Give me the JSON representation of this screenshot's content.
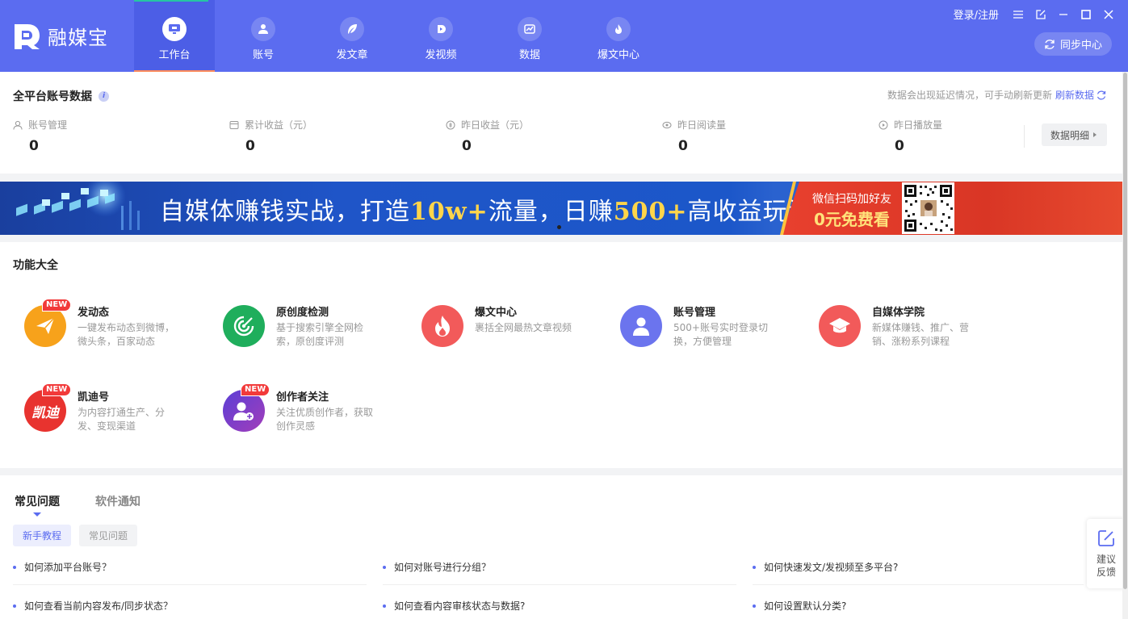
{
  "app": {
    "logo_text": "融媒宝"
  },
  "nav": {
    "tabs": [
      {
        "label": "工作台",
        "icon": "monitor-icon"
      },
      {
        "label": "账号",
        "icon": "user-icon"
      },
      {
        "label": "发文章",
        "icon": "feather-icon"
      },
      {
        "label": "发视频",
        "icon": "play-icon"
      },
      {
        "label": "数据",
        "icon": "chart-icon"
      },
      {
        "label": "爆文中心",
        "icon": "flame-icon"
      }
    ],
    "active_index": 0
  },
  "header": {
    "login_label": "登录/注册",
    "sync_label": "同步中心"
  },
  "stats": {
    "title": "全平台账号数据",
    "note": "数据会出现延迟情况，可手动刷新更新",
    "refresh_label": "刷新数据",
    "items": [
      {
        "label": "账号管理",
        "value": "0"
      },
      {
        "label": "累计收益（元）",
        "value": "0"
      },
      {
        "label": "昨日收益（元）",
        "value": "0"
      },
      {
        "label": "昨日阅读量",
        "value": "0"
      },
      {
        "label": "昨日播放量",
        "value": "0"
      }
    ],
    "detail_label": "数据明细"
  },
  "banner": {
    "text_a": "自媒体赚钱实战，打造",
    "text_hl1": "10w+",
    "text_b": "流量，日赚",
    "text_hl2": "500+",
    "text_c": "高收益玩法",
    "sub1": "微信扫码加好友",
    "sub2": "0元免费看"
  },
  "features": {
    "title": "功能大全",
    "badge_text": "NEW",
    "items": [
      {
        "name": "发动态",
        "desc": "一键发布动态到微博，微头条，百家动态",
        "badge": true,
        "color": "#f7a21b"
      },
      {
        "name": "原创度检测",
        "desc": "基于搜索引擎全网检索，原创度评测",
        "badge": false,
        "color": "#1fae5c"
      },
      {
        "name": "爆文中心",
        "desc": "裹括全网最热文章视频",
        "badge": false,
        "color": "#f25a5a"
      },
      {
        "name": "账号管理",
        "desc": "500+账号实时登录切换，方便管理",
        "badge": false,
        "color": "#6b74ee"
      },
      {
        "name": "自媒体学院",
        "desc": "新媒体赚钱、推广、营销、涨粉系列课程",
        "badge": false,
        "color": "#f25a5a"
      },
      {
        "name": "凯迪号",
        "desc": "为内容打通生产、分发、变现渠道",
        "badge": true,
        "color": "#e8332f",
        "logo_text": "凯迪"
      },
      {
        "name": "创作者关注",
        "desc": "关注优质创作者，获取创作灵感",
        "badge": true,
        "color": "#7a3fc9"
      }
    ]
  },
  "faq": {
    "tabs": [
      "常见问题",
      "软件通知"
    ],
    "pills": [
      "新手教程",
      "常见问题"
    ],
    "questions": [
      "如何添加平台账号？",
      "如何对账号进行分组？",
      "如何快速发文/发视频至多平台?",
      "如何查看当前内容发布/同步状态？",
      "如何查看内容审核状态与数据?",
      "如何设置默认分类?"
    ]
  },
  "feedback": {
    "label": "建议反馈"
  }
}
